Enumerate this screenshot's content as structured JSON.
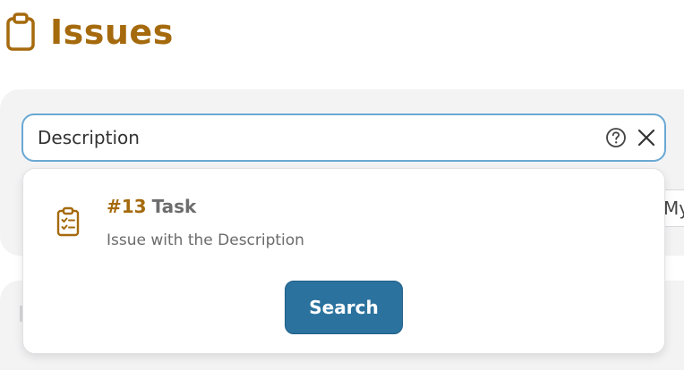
{
  "header": {
    "title": "Issues",
    "icon": "clipboard-icon"
  },
  "search": {
    "value": "Description",
    "help_icon": "help-circle-icon",
    "clear_icon": "close-icon"
  },
  "dropdown": {
    "results": [
      {
        "number": "#13",
        "type": "Task",
        "description": "Issue with the Description",
        "icon": "clipboard-check-icon"
      }
    ],
    "search_button_label": "Search"
  },
  "filters": {
    "partial_label": "My"
  },
  "colors": {
    "accent": "#a56a0d",
    "primary_button": "#2b729e",
    "input_border": "#6aa8d4",
    "panel_bg": "#f3f3f4"
  }
}
